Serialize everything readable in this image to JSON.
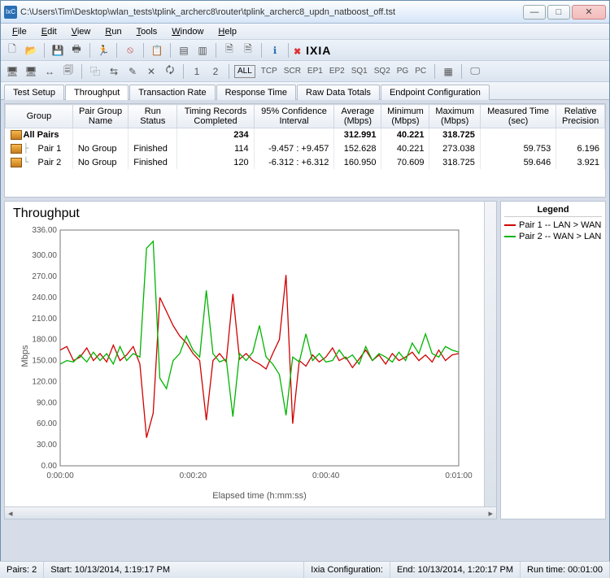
{
  "window": {
    "app_badge": "IxC",
    "title": "C:\\Users\\Tim\\Desktop\\wlan_tests\\tplink_archerc8\\router\\tplink_archerc8_updn_natboost_off.tst"
  },
  "menu": [
    "File",
    "Edit",
    "View",
    "Run",
    "Tools",
    "Window",
    "Help"
  ],
  "toolbar2": {
    "all": "ALL",
    "items": [
      "TCP",
      "SCR",
      "EP1",
      "EP2",
      "SQ1",
      "SQ2",
      "PG",
      "PC"
    ]
  },
  "tabs": [
    "Test Setup",
    "Throughput",
    "Transaction Rate",
    "Response Time",
    "Raw Data Totals",
    "Endpoint Configuration"
  ],
  "active_tab": 1,
  "columns": [
    "Group",
    "Pair Group Name",
    "Run Status",
    "Timing Records Completed",
    "95% Confidence Interval",
    "Average (Mbps)",
    "Minimum (Mbps)",
    "Maximum (Mbps)",
    "Measured Time (sec)",
    "Relative Precision"
  ],
  "rows": [
    {
      "group": "All Pairs",
      "pgn": "",
      "status": "",
      "trc": "234",
      "ci": "",
      "avg": "312.991",
      "min": "40.221",
      "max": "318.725",
      "mt": "",
      "rp": "",
      "bold": true
    },
    {
      "group": "Pair 1",
      "pgn": "No Group",
      "status": "Finished",
      "trc": "114",
      "ci": "-9.457 : +9.457",
      "avg": "152.628",
      "min": "40.221",
      "max": "273.038",
      "mt": "59.753",
      "rp": "6.196",
      "bold": false
    },
    {
      "group": "Pair 2",
      "pgn": "No Group",
      "status": "Finished",
      "trc": "120",
      "ci": "-6.312 : +6.312",
      "avg": "160.950",
      "min": "70.609",
      "max": "318.725",
      "mt": "59.646",
      "rp": "3.921",
      "bold": false
    }
  ],
  "chart_title": "Throughput",
  "legend_title": "Legend",
  "legend": [
    {
      "name": "Pair 1 -- LAN > WAN",
      "color": "#d00000"
    },
    {
      "name": "Pair 2 -- WAN > LAN",
      "color": "#00b400"
    }
  ],
  "chart_data": {
    "type": "line",
    "title": "Throughput",
    "xlabel": "Elapsed time (h:mm:ss)",
    "ylabel": "Mbps",
    "ylim": [
      0,
      336
    ],
    "yticks": [
      0,
      30,
      60,
      90,
      120,
      150,
      180,
      210,
      240,
      270,
      300,
      336
    ],
    "xticks": [
      "0:00:00",
      "0:00:20",
      "0:00:40",
      "0:01:00"
    ],
    "x": [
      0,
      1,
      2,
      3,
      4,
      5,
      6,
      7,
      8,
      9,
      10,
      11,
      12,
      13,
      14,
      15,
      16,
      17,
      18,
      19,
      20,
      21,
      22,
      23,
      24,
      25,
      26,
      27,
      28,
      29,
      30,
      31,
      32,
      33,
      34,
      35,
      36,
      37,
      38,
      39,
      40,
      41,
      42,
      43,
      44,
      45,
      46,
      47,
      48,
      49,
      50,
      51,
      52,
      53,
      54,
      55,
      56,
      57,
      58,
      59,
      60
    ],
    "series": [
      {
        "name": "Pair 1 -- LAN > WAN",
        "color": "#d00000",
        "values": [
          165,
          170,
          150,
          155,
          168,
          150,
          160,
          148,
          172,
          150,
          158,
          170,
          145,
          40,
          75,
          240,
          220,
          200,
          185,
          175,
          160,
          150,
          65,
          150,
          160,
          148,
          245,
          152,
          160,
          150,
          145,
          138,
          160,
          180,
          272,
          60,
          150,
          142,
          158,
          148,
          155,
          168,
          150,
          155,
          140,
          152,
          165,
          150,
          158,
          145,
          160,
          150,
          155,
          162,
          150,
          158,
          148,
          165,
          150,
          158,
          160
        ]
      },
      {
        "name": "Pair 2 -- WAN > LAN",
        "color": "#00b400",
        "values": [
          145,
          150,
          148,
          158,
          148,
          162,
          150,
          160,
          145,
          170,
          150,
          160,
          155,
          310,
          320,
          125,
          110,
          150,
          160,
          185,
          165,
          155,
          250,
          160,
          148,
          152,
          70,
          160,
          150,
          162,
          200,
          155,
          145,
          130,
          72,
          155,
          148,
          188,
          150,
          160,
          148,
          150,
          165,
          152,
          158,
          145,
          170,
          150,
          160,
          155,
          148,
          162,
          150,
          175,
          160,
          188,
          160,
          155,
          170,
          165,
          162
        ]
      }
    ]
  },
  "status": {
    "pairs": "Pairs: 2",
    "start": "Start: 10/13/2014, 1:19:17 PM",
    "ixia": "Ixia Configuration:",
    "end": "End: 10/13/2014, 1:20:17 PM",
    "runtime": "Run time: 00:01:00"
  }
}
